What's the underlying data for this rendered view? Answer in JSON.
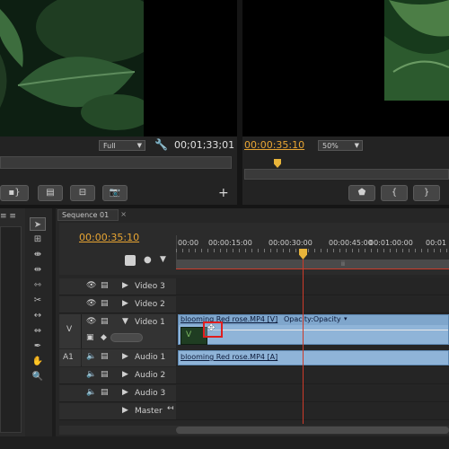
{
  "source_monitor": {
    "zoom": "Full",
    "timecode": "00;01;33;01"
  },
  "program_monitor": {
    "timecode": "00:00:35:10",
    "zoom": "50%"
  },
  "sequence": {
    "tab_label": "Sequence 01",
    "timecode": "00:00:35:10",
    "ruler": [
      "00:00",
      "00:00:15:00",
      "00:00:30:00",
      "00:00:45:00",
      "00:01:00:00",
      "00:01"
    ],
    "tracks": {
      "video3": "Video 3",
      "video2": "Video 2",
      "video1": "Video 1",
      "video_target": "V",
      "audio1": "Audio 1",
      "audio_target": "A1",
      "audio2": "Audio 2",
      "audio3": "Audio 3",
      "master": "Master"
    },
    "video_clip": {
      "name": "blooming Red rose.MP4 [V]",
      "effect": "Opacity:Opacity"
    },
    "audio_clip": {
      "name": "blooming Red rose.MP4 [A]"
    }
  },
  "colors": {
    "accent_timecode": "#e8a533",
    "clip_blue": "#8fb4d8",
    "playhead": "#cc3b2a"
  }
}
